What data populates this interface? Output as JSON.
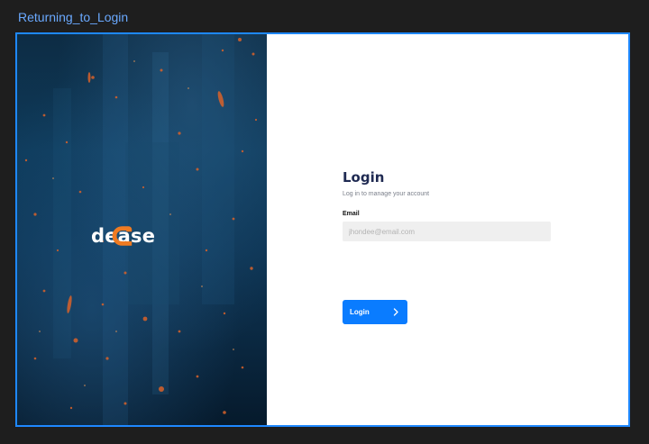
{
  "frame": {
    "title": "Returning_to_Login"
  },
  "brand": {
    "name": "dease",
    "accent_color": "#f07b22",
    "logo_icon": "dease-logo-icon"
  },
  "login": {
    "title": "Login",
    "subtitle": "Log in to manage your account",
    "email_label": "Email",
    "email_placeholder": "jhondee@email.com",
    "button_label": "Login",
    "button_icon": "chevron-right-icon",
    "button_color": "#0a7cff"
  },
  "background": {
    "image": "rainy-window-photo",
    "colors": [
      "#0d2c44",
      "#0e3a5a",
      "#061a2c"
    ]
  }
}
